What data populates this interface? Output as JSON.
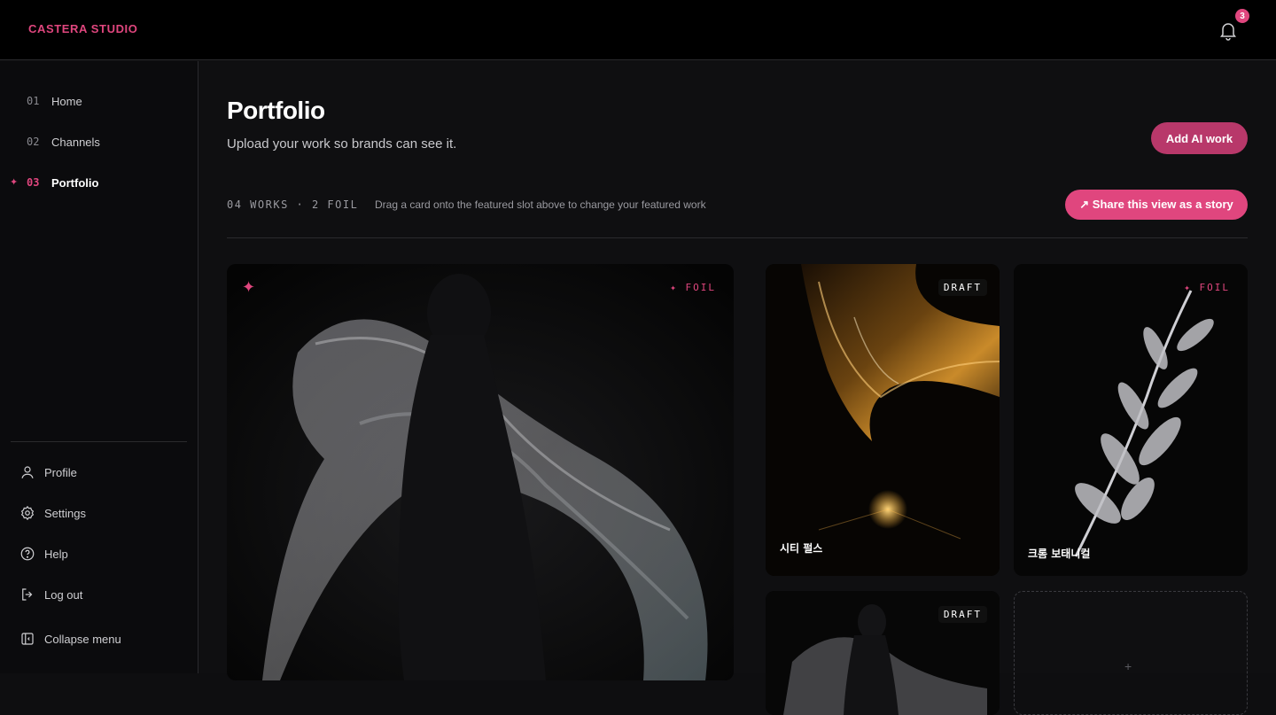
{
  "brand": "CASTERA STUDIO",
  "notifications": {
    "count": "3",
    "icon": "bell-icon"
  },
  "nav": [
    {
      "num": "01",
      "label": "Home"
    },
    {
      "num": "02",
      "label": "Channels"
    },
    {
      "num": "03",
      "label": "Portfolio",
      "active": true
    }
  ],
  "active_marker": "✦",
  "side_links": [
    {
      "label": "Profile",
      "icon": "user-icon"
    },
    {
      "label": "Settings",
      "icon": "gear-icon"
    },
    {
      "label": "Help",
      "icon": "help-icon"
    },
    {
      "label": "Log out",
      "icon": "logout-icon"
    },
    {
      "label": "Collapse menu",
      "icon": "collapse-icon"
    }
  ],
  "page": {
    "title": "Portfolio",
    "subtitle": "Upload your work so brands can see it.",
    "add_button": "Add AI work",
    "stats": "04 WORKS · 2 FOIL",
    "hint": "Drag a card onto the featured slot above to change your featured work",
    "share_button": "↗ Share this view as a story"
  },
  "cards": {
    "featured": {
      "tag": "✦ FOIL",
      "star": "✦"
    },
    "card1": {
      "tag": "DRAFT",
      "title": "시티 펄스"
    },
    "card2": {
      "tag": "✦ FOIL",
      "title": "크롬 보태니컬"
    },
    "card3": {
      "tag": "DRAFT"
    },
    "empty": {
      "plus": "+"
    }
  },
  "colors": {
    "accent": "#e0467e",
    "accent_dark": "#b8386a"
  }
}
